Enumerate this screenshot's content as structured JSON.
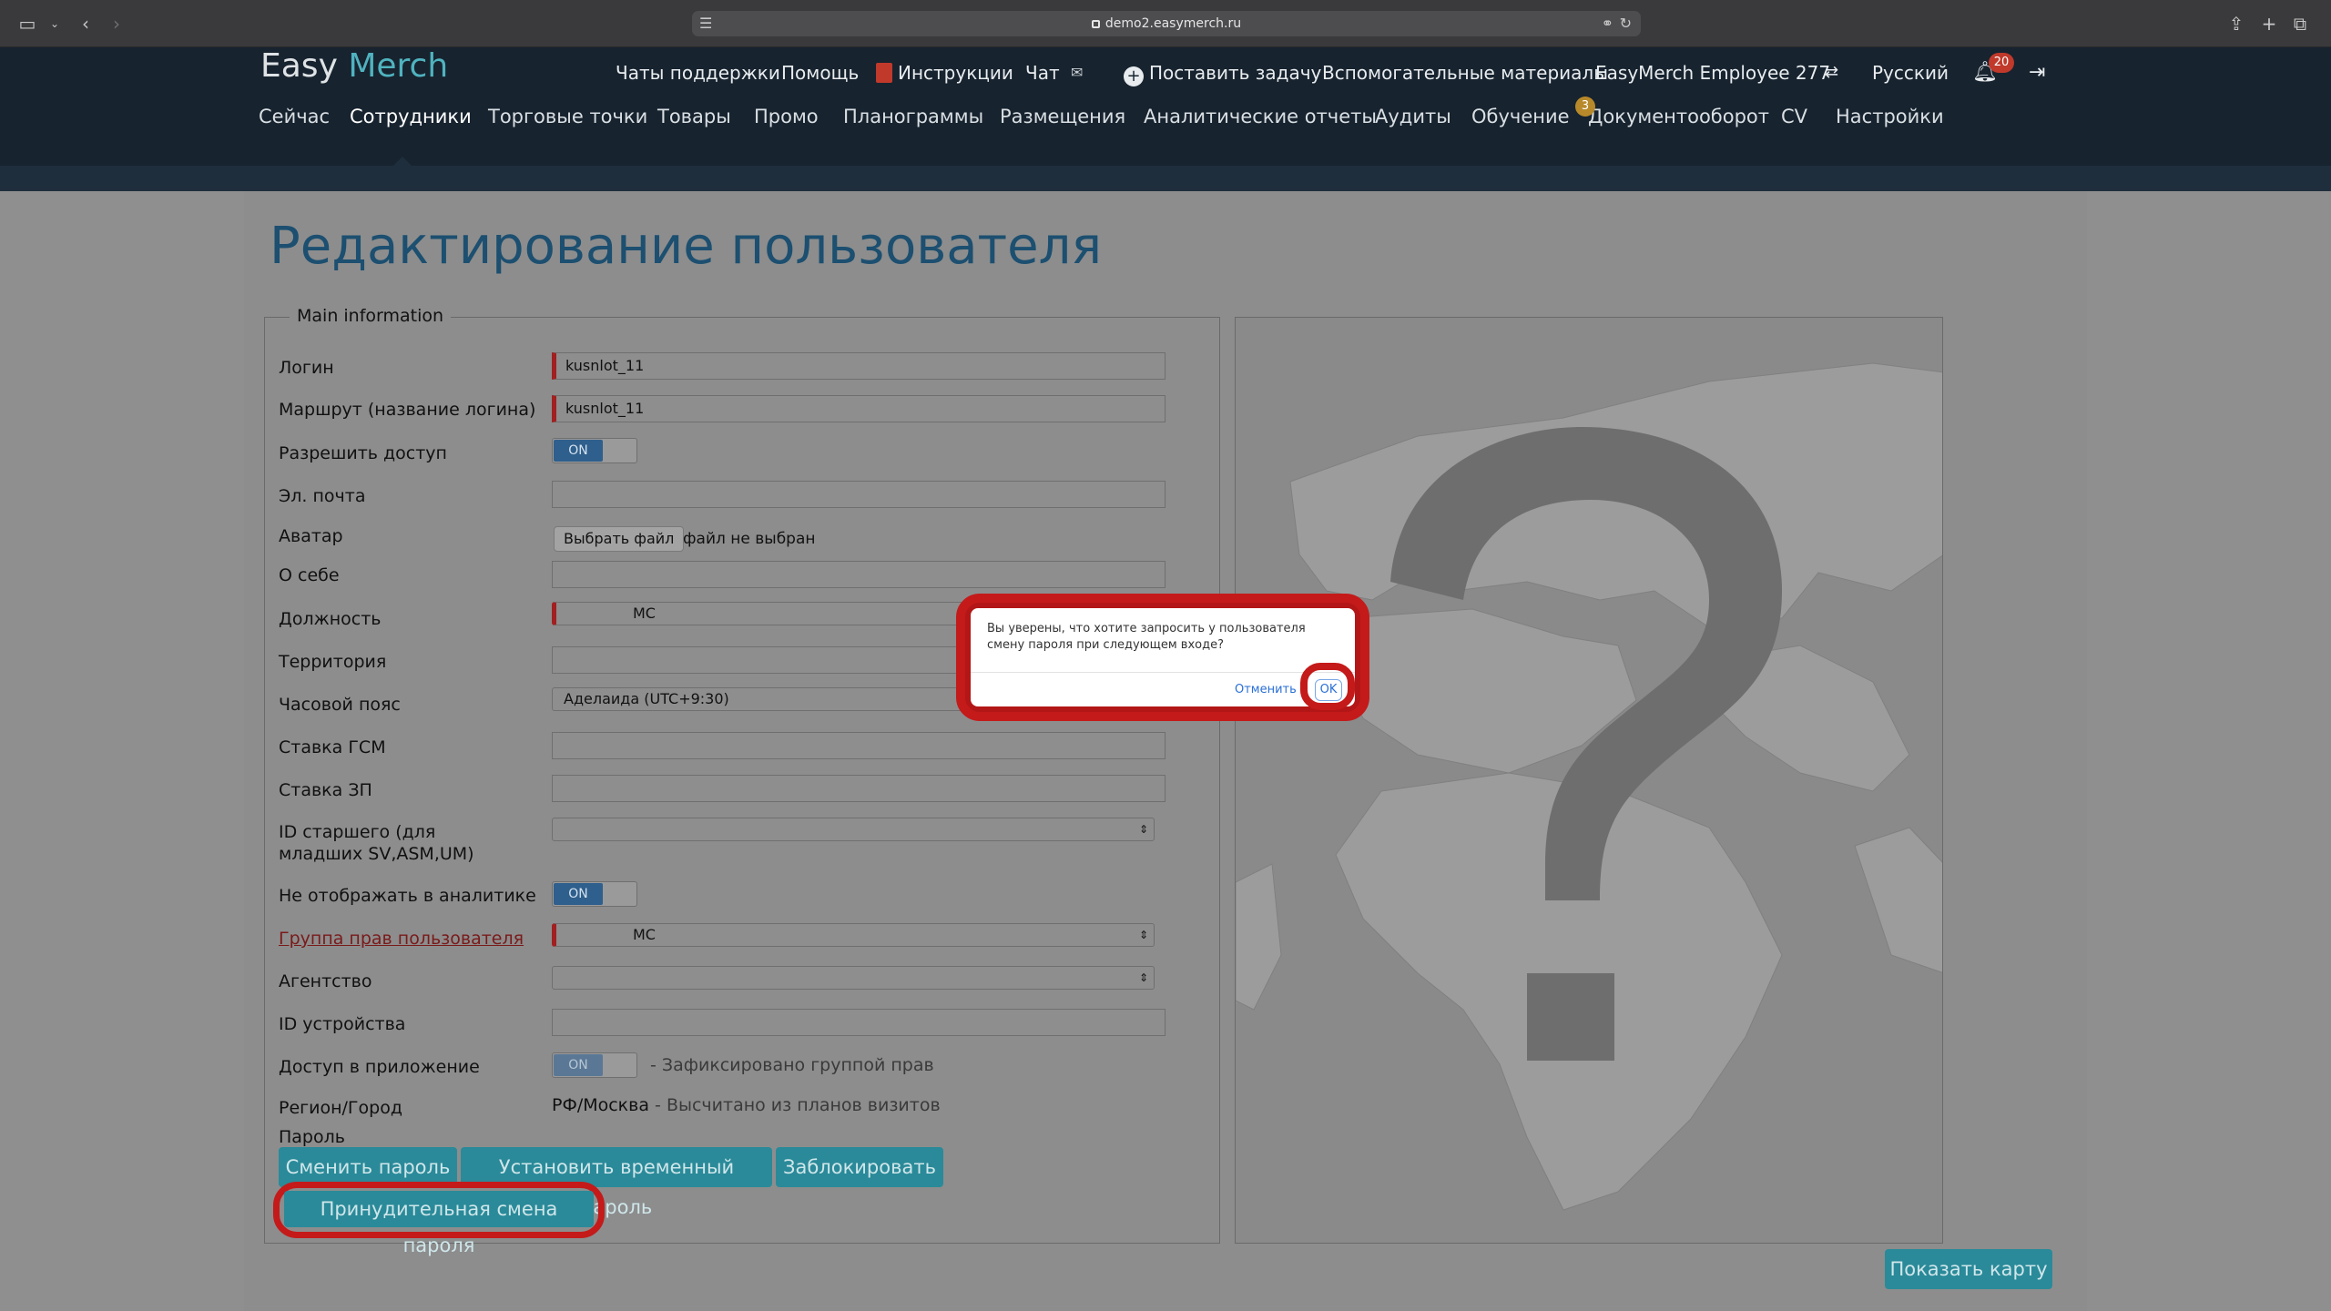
{
  "browser": {
    "url": "demo2.easymerch.ru"
  },
  "logo": {
    "part1": "Easy",
    "part2": "Merch"
  },
  "topnav": {
    "support_chats": "Чаты поддержки",
    "help": "Помощь",
    "instructions": "Инструкции",
    "chat": "Чат",
    "set_task": "Поставить задачу",
    "materials": "Вспомогательные материалы",
    "user": "EasyMerch Employee 277",
    "language": "Русский",
    "notifications_count": "20"
  },
  "mainnav": {
    "items": [
      "Сейчас",
      "Сотрудники",
      "Торговые точки",
      "Товары",
      "Промо",
      "Планограммы",
      "Размещения",
      "Аналитические отчеты",
      "Аудиты",
      "Обучение",
      "Документооборот",
      "CV",
      "Настройки"
    ],
    "active": "Сотрудники",
    "docflow_badge": "3"
  },
  "page": {
    "title": "Редактирование пользователя",
    "section_legend": "Main information"
  },
  "form": {
    "login_label": "Логин",
    "login_value": "kusnlot_11",
    "route_label": "Маршрут (название логина)",
    "route_value": "kusnlot_11",
    "allow_access_label": "Разрешить доступ",
    "allow_access_value": "ON",
    "email_label": "Эл. почта",
    "avatar_label": "Аватар",
    "avatar_button": "Выбрать файл",
    "avatar_status": "файл не выбран",
    "about_label": "О себе",
    "position_label": "Должность",
    "position_value": "MC",
    "territory_label": "Территория",
    "timezone_label": "Часовой пояс",
    "timezone_value": "Аделаида (UTC+9:30)",
    "fuel_rate_label": "Ставка ГСМ",
    "salary_rate_label": "Ставка ЗП",
    "senior_id_label": "ID старшего (для младших SV,ASM,UM)",
    "hide_analytics_label": "Не отображать в аналитике",
    "hide_analytics_value": "ON",
    "rights_group_label": "Группа прав пользователя",
    "rights_group_value": "MC",
    "agency_label": "Агентство",
    "device_id_label": "ID устройства",
    "app_access_label": "Доступ в приложение",
    "app_access_value": "ON",
    "app_access_note": "- Зафиксировано группой прав",
    "region_label": "Регион/Город",
    "region_value": "РФ/Москва",
    "region_note": "- Высчитано из планов визитов",
    "password_label": "Пароль"
  },
  "buttons": {
    "change_password": "Сменить пароль",
    "temp_password": "Установить временный пароль",
    "block": "Заблокировать",
    "force_change": "Принудительная смена пароля",
    "show_map": "Показать карту"
  },
  "dialog": {
    "message": "Вы уверены, что хотите запросить у пользователя смену пароля при следующем входе?",
    "cancel": "Отменить",
    "ok": "OK"
  },
  "colors": {
    "header_bg": "#17232f",
    "accent_teal": "#2a8a99",
    "title_blue": "#1c4f70",
    "highlight_red": "#c41a1a"
  }
}
